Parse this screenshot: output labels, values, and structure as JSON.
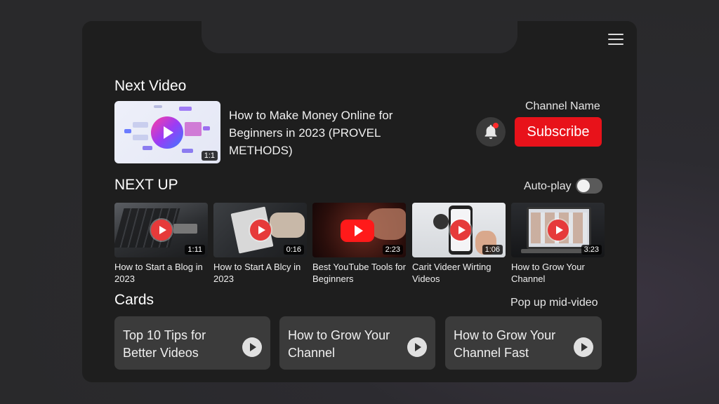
{
  "sections": {
    "next_video": "Next Video",
    "next_up": "NEXT UP",
    "cards": "Cards"
  },
  "next_video": {
    "title": "How to Make Money Online for Beginners in 2023 (PROVEL METHODS)",
    "duration": "1:1",
    "channel_name": "Channel Name",
    "subscribe_label": "Subscribe",
    "notification_count": "1"
  },
  "autoplay": {
    "label": "Auto-play",
    "enabled": false
  },
  "next_up": [
    {
      "title": "How to Start a Blog in 2023",
      "duration": "1:11"
    },
    {
      "title": "How to Start A Blcy in 2023",
      "duration": "0:16"
    },
    {
      "title": "Best YouTube Tools for Beginners",
      "duration": "2:23"
    },
    {
      "title": "Carit Videer Wirting Videos",
      "duration": "1:06"
    },
    {
      "title": "How to Grow Your Channel",
      "duration": "3:23"
    }
  ],
  "cards": {
    "popup_label": "Pop up mid-video",
    "items": [
      {
        "title": "Top 10 Tips for Better Videos"
      },
      {
        "title": "How to Grow Your Channel"
      },
      {
        "title": "How to Grow Your Channel Fast"
      }
    ]
  },
  "colors": {
    "accent_red": "#e8121a",
    "panel": "#1e1e1e",
    "card": "#3b3b3b"
  },
  "icons": [
    "menu-icon",
    "bell-icon",
    "play-icon",
    "toggle-switch"
  ]
}
